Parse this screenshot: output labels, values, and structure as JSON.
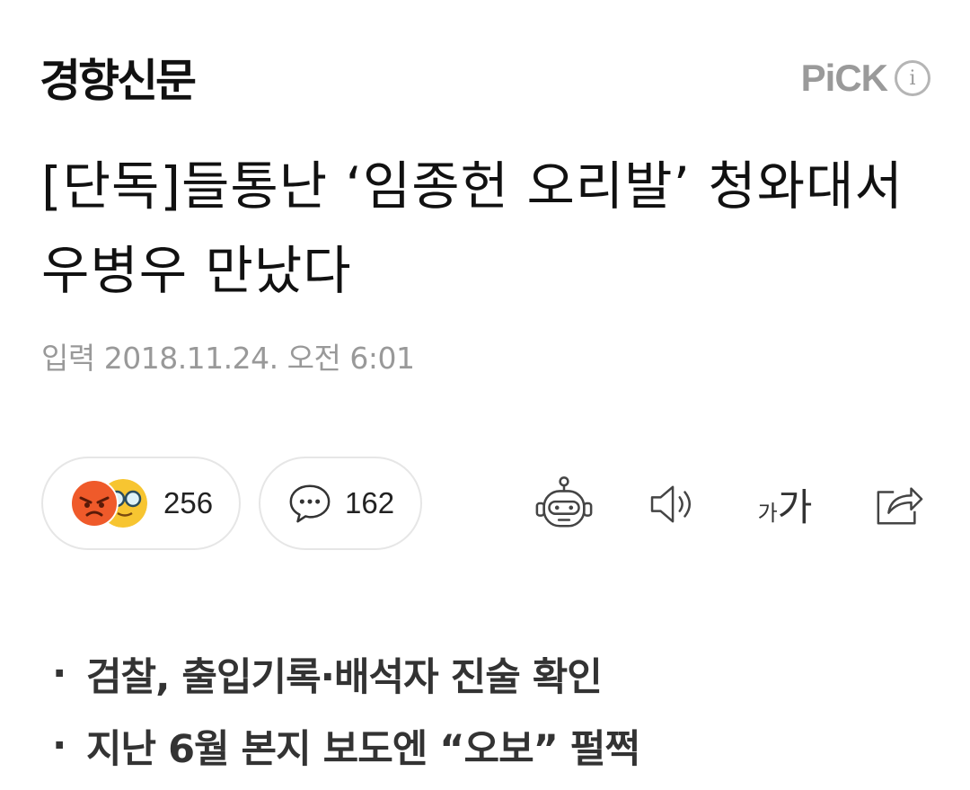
{
  "header": {
    "press_name": "경향신문",
    "pick_label": "PiCK",
    "info_icon": "i"
  },
  "article": {
    "headline": "[단독]들통난 ‘임종헌 오리발’ 청와대서 우병우 만났다",
    "timestamp": "입력 2018.11.24. 오전 6:01"
  },
  "actions": {
    "reaction_count": "256",
    "comment_count": "162",
    "font_small": "가",
    "font_big": "가"
  },
  "summary": [
    "검찰, 출입기록·배석자 진술 확인",
    "지난 6월 본지 보도엔 “오보” 펄쩍"
  ],
  "colors": {
    "angry_emoji": "#ef5a2a",
    "nerd_emoji": "#f7c531",
    "muted_text": "#999999",
    "pill_border": "#e6e6e6"
  },
  "icons": [
    "info-icon",
    "angry-emoji-icon",
    "nerd-emoji-icon",
    "comment-icon",
    "robot-icon",
    "speaker-icon",
    "font-size-icon",
    "share-icon"
  ]
}
